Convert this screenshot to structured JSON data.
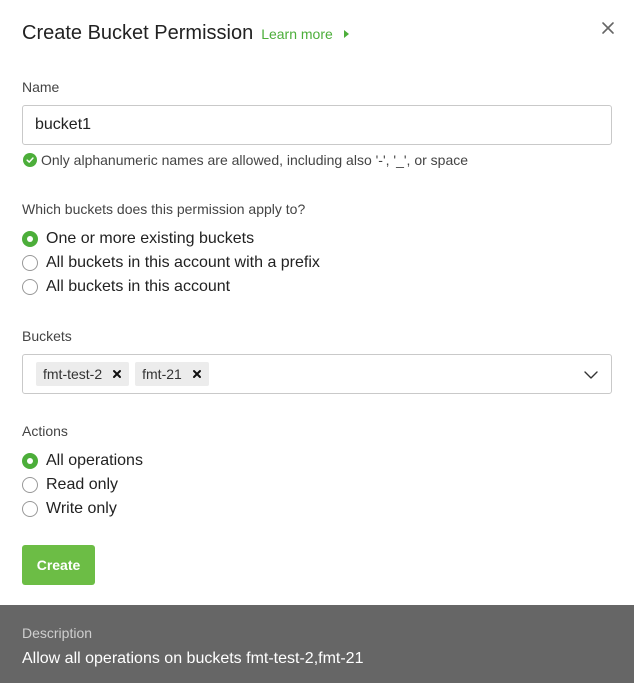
{
  "header": {
    "title": "Create Bucket Permission",
    "learn_more": "Learn more",
    "close_icon": "close-icon"
  },
  "name_field": {
    "label": "Name",
    "value": "bucket1",
    "hint": "Only alphanumeric names are allowed, including also '-', '_', or space",
    "hint_icon": "check-circle-icon"
  },
  "scope": {
    "question": "Which buckets does this permission apply to?",
    "options": [
      {
        "label": "One or more existing buckets",
        "selected": true
      },
      {
        "label": "All buckets in this account with a prefix",
        "selected": false
      },
      {
        "label": "All buckets in this account",
        "selected": false
      }
    ]
  },
  "buckets": {
    "label": "Buckets",
    "selected": [
      "fmt-test-2",
      "fmt-21"
    ],
    "dropdown_icon": "chevron-down-icon"
  },
  "actions": {
    "label": "Actions",
    "options": [
      {
        "label": "All operations",
        "selected": true
      },
      {
        "label": "Read only",
        "selected": false
      },
      {
        "label": "Write only",
        "selected": false
      }
    ]
  },
  "create_button": "Create",
  "description": {
    "label": "Description",
    "text": "Allow all operations on buckets fmt-test-2,fmt-21"
  },
  "colors": {
    "accent": "#6cbd45",
    "link": "#4cae3a",
    "footer_bg": "#666666"
  }
}
